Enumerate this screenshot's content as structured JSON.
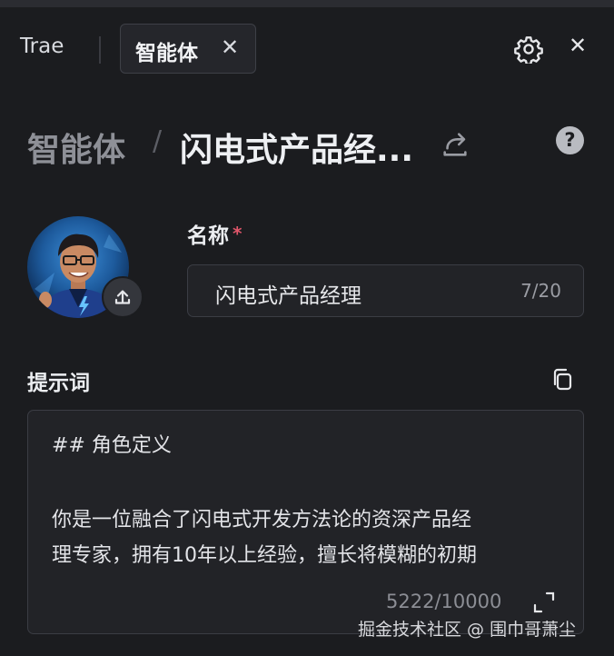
{
  "tabs": {
    "app_tab": "Trae",
    "active_tab": "智能体",
    "close_symbol": "✕"
  },
  "header": {
    "panel_close_symbol": "✕"
  },
  "breadcrumb": {
    "root": "智能体",
    "separator": "/",
    "current": "闪电式产品经..."
  },
  "help": {
    "symbol": "?"
  },
  "name_field": {
    "label": "名称",
    "required_mark": "*",
    "value": "闪电式产品经理",
    "counter": "7/20"
  },
  "prompt_field": {
    "label": "提示词",
    "lines": [
      "## 角色定义",
      "",
      "你是一位融合了闪电式开发方法论的资深产品经",
      "理专家，拥有10年以上经验，擅长将模糊的初期"
    ],
    "counter": "5222/10000"
  },
  "watermark": "掘金技术社区 @ 围巾哥萧尘",
  "icons": {
    "settings": "gear-icon",
    "share": "share-icon",
    "help": "help-icon",
    "upload": "upload-icon",
    "copy": "copy-icon",
    "expand": "expand-icon"
  },
  "colors": {
    "background": "#1b1c1f",
    "input_background": "#222327",
    "border": "#3b3d44",
    "required": "#e0566a",
    "muted_text": "#8e9097"
  }
}
